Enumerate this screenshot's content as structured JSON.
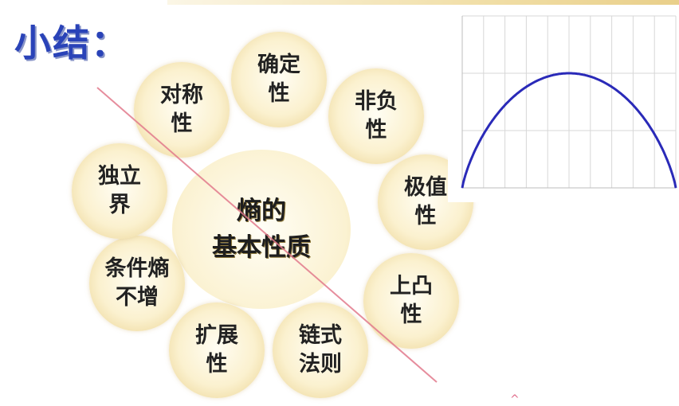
{
  "title": "小结：",
  "center": "熵的\n基本性质",
  "petals": [
    {
      "label": "确定\n性"
    },
    {
      "label": "非负\n性"
    },
    {
      "label": "极值\n性"
    },
    {
      "label": "上凸\n性"
    },
    {
      "label": "链式\n法则"
    },
    {
      "label": "扩展\n性"
    },
    {
      "label": "条件熵\n不增"
    },
    {
      "label": "独立\n界"
    },
    {
      "label": "对称\n性"
    }
  ],
  "chart_data": {
    "type": "line",
    "x": [
      0,
      0.1,
      0.2,
      0.3,
      0.4,
      0.5,
      0.6,
      0.7,
      0.8,
      0.9,
      1.0
    ],
    "y": [
      0,
      0.469,
      0.722,
      0.881,
      0.971,
      1.0,
      0.971,
      0.881,
      0.722,
      0.469,
      0
    ],
    "xlim": [
      0,
      1
    ],
    "ylim": [
      0,
      1.5
    ],
    "grid": true,
    "color": "#2a2ab8"
  },
  "colors": {
    "title": "#2a43b8",
    "petal": "#fbf1cf",
    "curve": "#2a2ab8",
    "slash": "#e27a8c"
  }
}
